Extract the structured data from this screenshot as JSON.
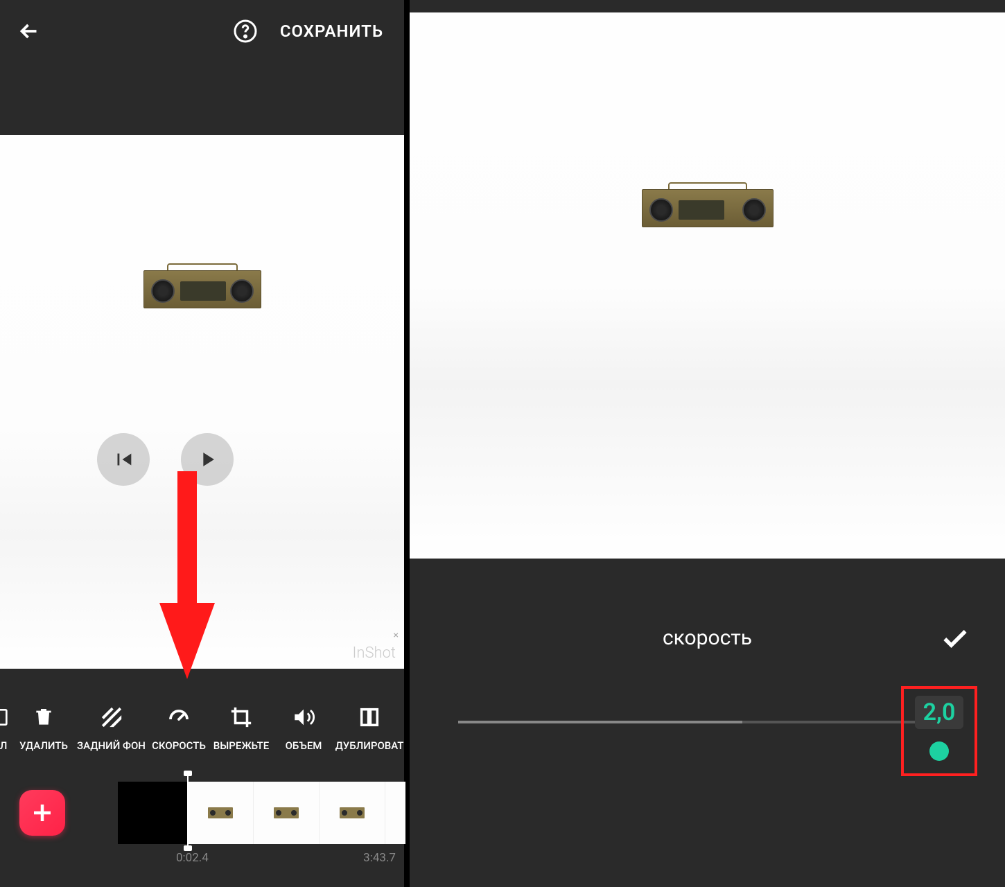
{
  "left": {
    "header": {
      "save_label": "СОХРАНИТЬ"
    },
    "watermark": "InShot",
    "toolbar": {
      "items": [
        {
          "id": "ol",
          "label": "ОЛ"
        },
        {
          "id": "delete",
          "label": "УДАЛИТЬ"
        },
        {
          "id": "background",
          "label": "ЗАДНИЙ ФОН"
        },
        {
          "id": "speed",
          "label": "СКОРОСТЬ"
        },
        {
          "id": "crop",
          "label": "ВЫРЕЖЬТЕ"
        },
        {
          "id": "volume",
          "label": "ОБЪЕМ"
        },
        {
          "id": "duplicate",
          "label": "ДУБЛИРОВАТ"
        }
      ]
    },
    "timeline": {
      "current": "0:02.4",
      "total": "3:43.7"
    }
  },
  "right": {
    "speed_title": "скорость",
    "speed_value": "2,0",
    "slider_percent": 57
  }
}
